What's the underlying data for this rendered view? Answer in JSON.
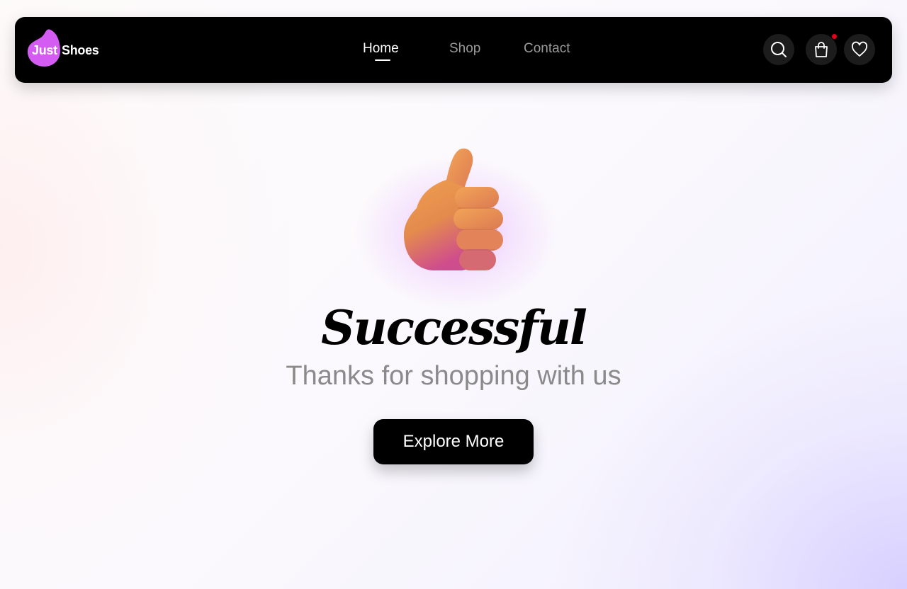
{
  "brand": {
    "name_part1": "Just",
    "name_part2": "Shoes",
    "accent_color": "#d55cf2"
  },
  "nav": {
    "links": [
      {
        "label": "Home",
        "active": true
      },
      {
        "label": "Shop",
        "active": false
      },
      {
        "label": "Contact",
        "active": false
      }
    ]
  },
  "actions": {
    "search_icon": "search-icon",
    "cart_icon": "shopping-bag-icon",
    "wishlist_icon": "heart-icon",
    "cart_badge_color": "#e5001c"
  },
  "hero": {
    "icon": "thumbs-up-icon",
    "title": "Successful",
    "subtitle": "Thanks for shopping with us",
    "button_label": "Explore More"
  }
}
